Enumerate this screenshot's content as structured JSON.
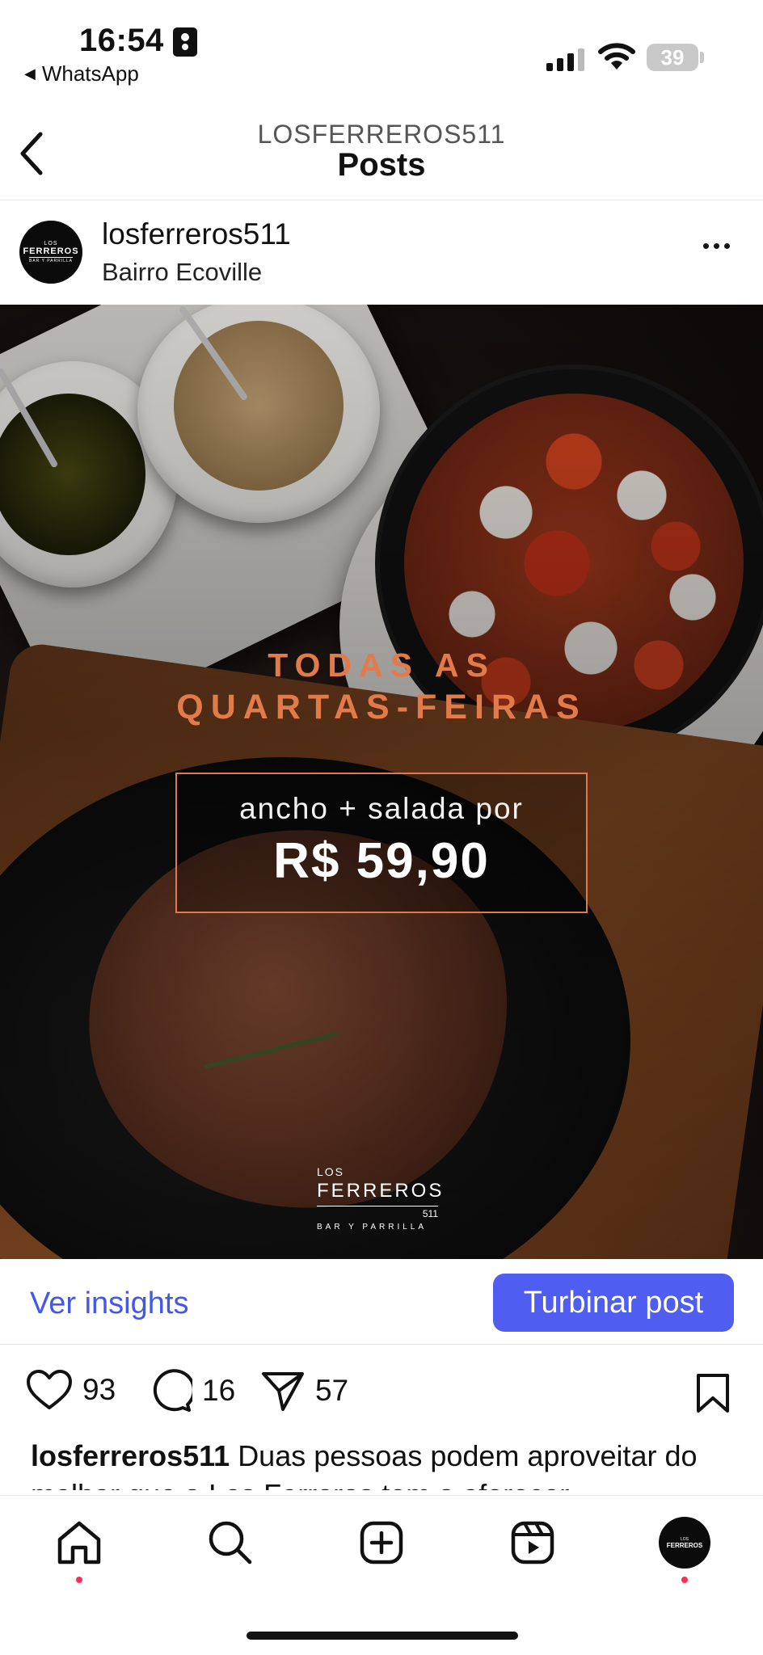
{
  "status_bar": {
    "time": "16:54",
    "back_app": "WhatsApp",
    "battery": "39"
  },
  "nav": {
    "subtitle": "LOSFERREROS511",
    "title": "Posts"
  },
  "post": {
    "username": "losferreros511",
    "location": "Bairro Ecoville",
    "image": {
      "headline_line1": "TODAS AS",
      "headline_line2": "QUARTAS-FEIRAS",
      "offer": "ancho + salada por",
      "price": "R$ 59,90",
      "logo_top": "LOS",
      "logo_name": "FERREROS",
      "logo_num": "511",
      "logo_sub": "BAR Y PARRILLA"
    },
    "insights_label": "Ver insights",
    "boost_label": "Turbinar post",
    "likes": "93",
    "comments": "16",
    "shares": "57",
    "caption_user": "losferreros511",
    "caption_text": "Duas pessoas podem aproveitar do melhor que a Los Ferreros tem a oferecer..."
  },
  "avatar_text": {
    "top": "LOS",
    "name": "FERREROS",
    "num": "511",
    "sub": "BAR Y PARRILLA"
  },
  "tabbar": {
    "icons": [
      "home-icon",
      "search-icon",
      "create-icon",
      "reels-icon",
      "profile-avatar"
    ]
  },
  "colors": {
    "accent": "#4f5df0",
    "link": "#4357e8",
    "headline": "#e27a4a",
    "notification_dot": "#ff2d55"
  }
}
